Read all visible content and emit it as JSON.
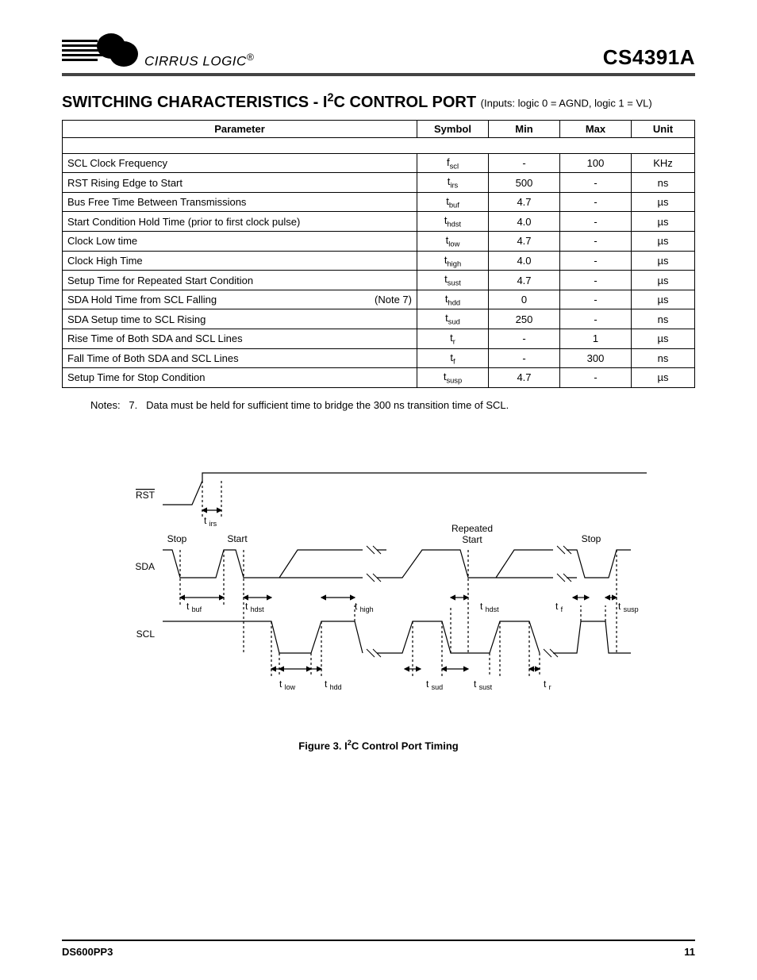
{
  "header": {
    "brand_text": "CIRRUS LOGIC",
    "reg_mark": "®",
    "part_number": "CS4391A"
  },
  "section": {
    "title_pre": "SWITCHING CHARACTERISTICS - I",
    "title_sup": "2",
    "title_post": "C CONTROL PORT",
    "conditions": "(Inputs:  logic 0 = AGND, logic 1 = VL)"
  },
  "table": {
    "headers": {
      "param": "Parameter",
      "symbol": "Symbol",
      "min": "Min",
      "max": "Max",
      "unit": "Unit"
    },
    "rows": [
      {
        "param": "SCL Clock Frequency",
        "sym_base": "f",
        "sym_sub": "scl",
        "min": "-",
        "max": "100",
        "unit": "KHz"
      },
      {
        "param": "RST Rising Edge to Start",
        "sym_base": "t",
        "sym_sub": "irs",
        "min": "500",
        "max": "-",
        "unit": "ns"
      },
      {
        "param": "Bus Free Time Between Transmissions",
        "sym_base": "t",
        "sym_sub": "buf",
        "min": "4.7",
        "max": "-",
        "unit": "µs"
      },
      {
        "param": "Start Condition Hold Time (prior to first clock pulse)",
        "sym_base": "t",
        "sym_sub": "hdst",
        "min": "4.0",
        "max": "-",
        "unit": "µs"
      },
      {
        "param": "Clock Low time",
        "sym_base": "t",
        "sym_sub": "low",
        "min": "4.7",
        "max": "-",
        "unit": "µs"
      },
      {
        "param": "Clock High Time",
        "sym_base": "t",
        "sym_sub": "high",
        "min": "4.0",
        "max": "-",
        "unit": "µs"
      },
      {
        "param": "Setup Time for Repeated Start Condition",
        "sym_base": "t",
        "sym_sub": "sust",
        "min": "4.7",
        "max": "-",
        "unit": "µs"
      },
      {
        "param": "SDA Hold Time from SCL Falling",
        "note": "(Note 7)",
        "sym_base": "t",
        "sym_sub": "hdd",
        "min": "0",
        "max": "-",
        "unit": "µs"
      },
      {
        "param": "SDA Setup time to SCL Rising",
        "sym_base": "t",
        "sym_sub": "sud",
        "min": "250",
        "max": "-",
        "unit": "ns"
      },
      {
        "param": "Rise Time of Both SDA and SCL Lines",
        "sym_base": "t",
        "sym_sub": "r",
        "min": "-",
        "max": "1",
        "unit": "µs"
      },
      {
        "param": "Fall Time of Both SDA and SCL Lines",
        "sym_base": "t",
        "sym_sub": "f",
        "min": "-",
        "max": "300",
        "unit": "ns"
      },
      {
        "param": "Setup Time for Stop Condition",
        "sym_base": "t",
        "sym_sub": "susp",
        "min": "4.7",
        "max": "-",
        "unit": "µs"
      }
    ]
  },
  "notes": {
    "label": "Notes:",
    "num": "7.",
    "text": "Data must be held for sufficient time to bridge the 300 ns transition time of SCL."
  },
  "figure": {
    "sig1": "RST",
    "sig2": "SDA",
    "sig3": "SCL",
    "l_stop": "Stop",
    "l_start": "Start",
    "l_rep": "Repeated",
    "l_rep2": "Start",
    "t_irs": "irs",
    "t_buf": "buf",
    "t_hdst": "hdst",
    "t_high": "high",
    "t_hdst2": "hdst",
    "t_f": "f",
    "t_susp": "susp",
    "t_low": "low",
    "t_hdd": "hdd",
    "t_sud": "sud",
    "t_sust": "sust",
    "t_r": "r",
    "caption_pre": "Figure 3.  I",
    "caption_sup": "2",
    "caption_post": "C Control Port Timing"
  },
  "footer": {
    "doc": "DS600PP3",
    "page": "11"
  }
}
